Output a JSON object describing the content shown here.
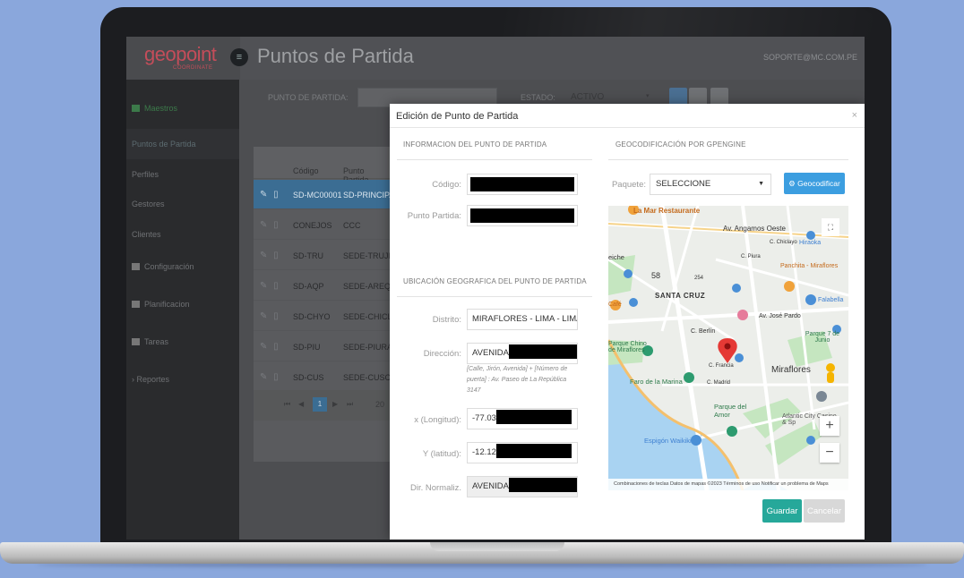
{
  "app": {
    "logo": "geopoint",
    "logo_sub": "COORDINATE",
    "page_title": "Puntos de Partida",
    "user_email": "SOPORTE@MC.COM.PE"
  },
  "sidebar": {
    "items": [
      {
        "label": "Maestros"
      },
      {
        "label": "Puntos de Partida"
      },
      {
        "label": "Perfiles"
      },
      {
        "label": "Gestores"
      },
      {
        "label": "Clientes"
      },
      {
        "label": "Configuración"
      },
      {
        "label": "Planificacion"
      },
      {
        "label": "Tareas"
      },
      {
        "label": "Reportes"
      }
    ]
  },
  "filters": {
    "punto_label": "PUNTO DE PARTIDA:",
    "estado_label": "ESTADO:",
    "estado_value": "ACTIVO"
  },
  "grid": {
    "col_codigo": "Código",
    "col_punto": "Punto Partida",
    "rows": [
      {
        "codigo": "SD-MC00001",
        "punto": "SD-PRINCIPAL"
      },
      {
        "codigo": "CONEJOS",
        "punto": "CCC"
      },
      {
        "codigo": "SD-TRU",
        "punto": "SEDE-TRUJILLO"
      },
      {
        "codigo": "SD-AQP",
        "punto": "SEDE-AREQUIPA"
      },
      {
        "codigo": "SD-CHYO",
        "punto": "SEDE-CHICLAYO"
      },
      {
        "codigo": "SD-PIU",
        "punto": "SEDE-PIURA"
      },
      {
        "codigo": "SD-CUS",
        "punto": "SEDE-CUSCO"
      }
    ],
    "pager": {
      "page": "1",
      "page_size": "20"
    }
  },
  "modal": {
    "title": "Edición de Punto de Partida",
    "close": "×",
    "section_info": "INFORMACION DEL PUNTO DE PARTIDA",
    "section_geo": "GEOCODIFICACIÓN POR GPENGINE",
    "section_ubic": "UBICACIÓN GEOGRAFICA DEL PUNTO DE PARTIDA",
    "fields": {
      "codigo_label": "Código:",
      "punto_label": "Punto Partida:",
      "distrito_label": "Distrito:",
      "distrito_value": "MIRAFLORES - LIMA - LIMA",
      "direccion_label": "Dirección:",
      "direccion_value": "AVENIDA",
      "direccion_help": "[Calle, Jirón, Avenida] + [Número de puerta] : Av. Paseo de La República 3147",
      "longitud_label": "x (Longitud):",
      "longitud_value": "-77.03",
      "latitud_label": "Y (latitud):",
      "latitud_value": "-12.12",
      "dirnorm_label": "Dir. Normaliz.",
      "dirnorm_value": "AVENIDA"
    },
    "paquete_label": "Paquete:",
    "paquete_value": "SELECCIONE",
    "geocode_button": "Geocodificar",
    "save_button": "Guardar",
    "cancel_button": "Cancelar"
  },
  "map": {
    "labels": [
      "La Mar Restaurante",
      "Av. Angamos Oeste",
      "C. Chiclayo",
      "Hiraoka",
      "C. Piura",
      "Panchita - Miraflores",
      "SANTA CRUZ",
      "Falabella",
      "Av. José Pardo",
      "C. Berlín",
      "Parque 7 de Junio",
      "Parque Chino de Miraflores",
      "C. Francia",
      "Miraflores",
      "Faro de la Marina",
      "C. Madrid",
      "Parque del Amor",
      "Atlantic City Casino & Sp",
      "Espigón Waikiki",
      "eiche",
      "58",
      "254",
      "Café"
    ],
    "attribution": "Combinaciones de teclas   Datos de mapas ©2023   Términos de uso   Notificar un problema de Maps",
    "marker_color": "#e53935",
    "water_color": "#a9d3f2",
    "park_color": "#c5e6c0"
  }
}
